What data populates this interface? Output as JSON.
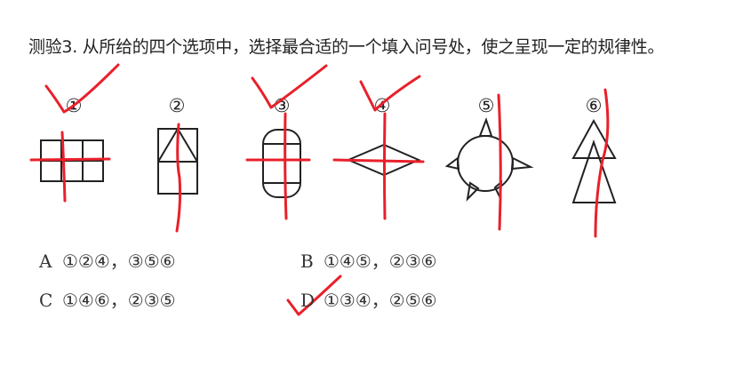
{
  "question": {
    "text": "测验3. 从所给的四个选项中，选择最合适的一个填入问号处，使之呈现一定的规律性。"
  },
  "figures": [
    {
      "label": "①",
      "check_mark": true
    },
    {
      "label": "②",
      "check_mark": false
    },
    {
      "label": "③",
      "check_mark": true
    },
    {
      "label": "④",
      "check_mark": true
    },
    {
      "label": "⑤",
      "check_mark": false
    },
    {
      "label": "⑥",
      "check_mark": false
    }
  ],
  "options": [
    {
      "letter": "A",
      "text": "①②④，③⑤⑥"
    },
    {
      "letter": "B",
      "text": "①④⑤，②③⑥"
    },
    {
      "letter": "C",
      "text": "①④⑥，②③⑤"
    },
    {
      "letter": "D",
      "text": "①③④，②⑤⑥",
      "check_mark": true
    }
  ],
  "colors": {
    "ink": "#222222",
    "annotation_red": "#e8202a"
  }
}
